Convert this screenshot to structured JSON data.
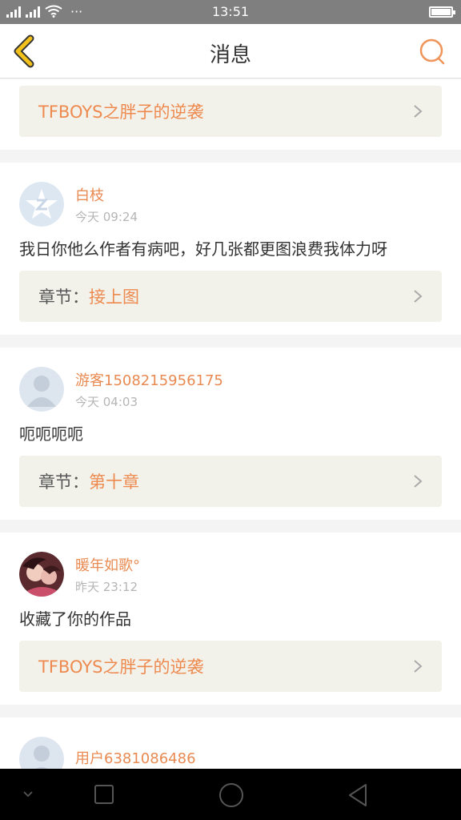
{
  "status": {
    "time": "13:51",
    "dots": "···"
  },
  "header": {
    "title": "消息"
  },
  "partial_top": {
    "ref_text": "TFBOYS之胖子的逆袭"
  },
  "messages": [
    {
      "user": "白枝",
      "time": "今天 09:24",
      "avatar": "qzone-avatar",
      "comment": "我日你他么作者有病吧，好几张都更图浪费我体力呀",
      "ref_prefix": "章节：",
      "ref_text": "接上图"
    },
    {
      "user": "游客1508215956175",
      "time": "今天 04:03",
      "avatar": "default-avatar",
      "comment": "呃呃呃呃",
      "ref_prefix": "章节：",
      "ref_text": "第十章"
    },
    {
      "user": "暖年如歌°",
      "time": "昨天 23:12",
      "avatar": "photo-avatar",
      "comment": "收藏了你的作品",
      "ref_prefix": "",
      "ref_text": "TFBOYS之胖子的逆袭"
    },
    {
      "user": "用户6381086486",
      "time": "",
      "avatar": "default-avatar",
      "comment": "",
      "ref_prefix": "",
      "ref_text": ""
    }
  ],
  "colors": {
    "accent": "#ee8a50",
    "icon_yellow": "#f2c21b"
  }
}
